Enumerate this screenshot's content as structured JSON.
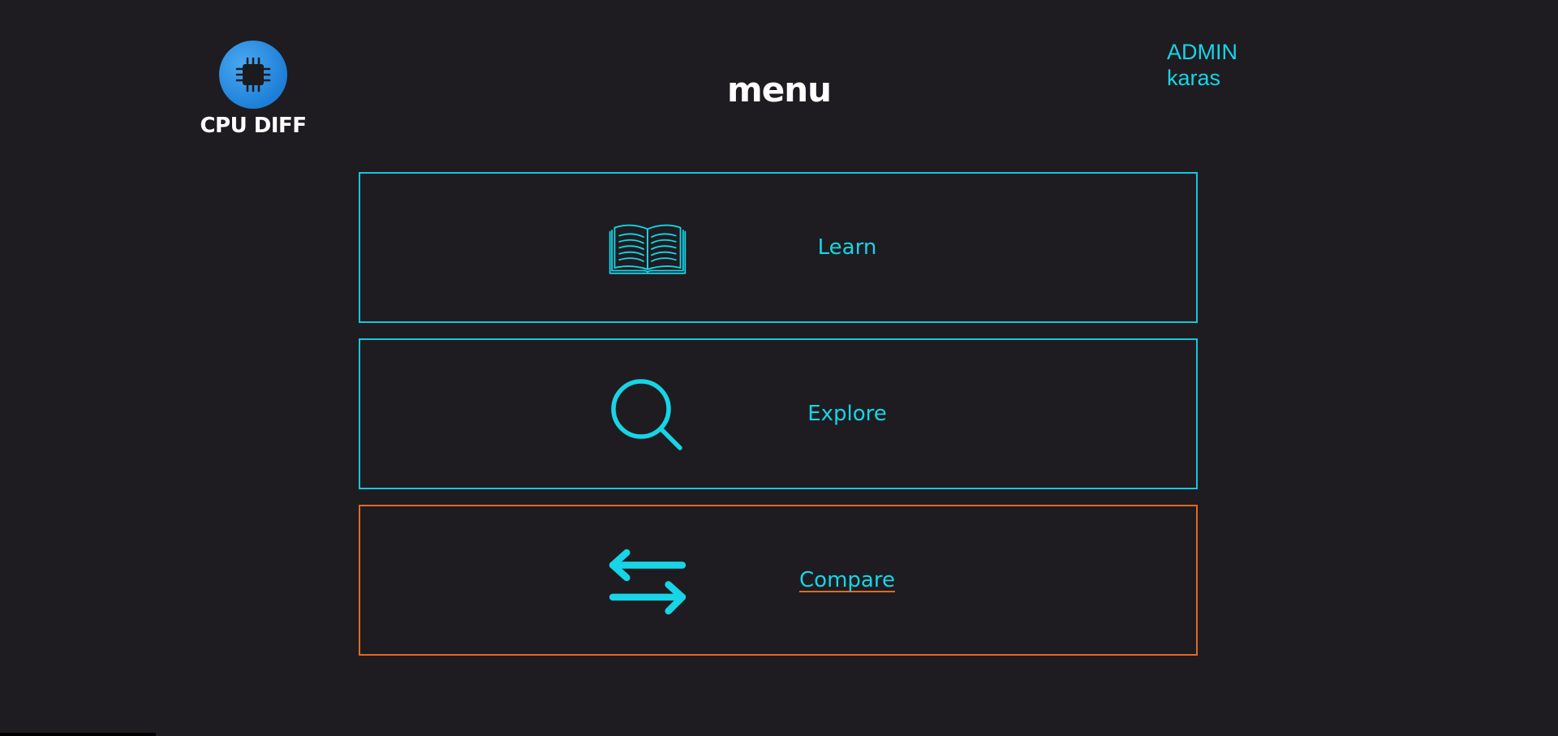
{
  "logo": {
    "text": "CPU DIFF",
    "icon": "cpu-chip-icon",
    "color": "#1e7fd8"
  },
  "header": {
    "title": "menu"
  },
  "user": {
    "role": "ADMIN",
    "name": "karas"
  },
  "menu": {
    "items": [
      {
        "label": "Learn",
        "icon": "open-book-icon",
        "active": false
      },
      {
        "label": "Explore",
        "icon": "search-icon",
        "active": false
      },
      {
        "label": "Compare",
        "icon": "swap-arrows-icon",
        "active": true
      }
    ]
  },
  "colors": {
    "background": "#1e1c20",
    "accent": "#17d4e6",
    "active_border": "#e06a24",
    "title": "#ffffff"
  }
}
